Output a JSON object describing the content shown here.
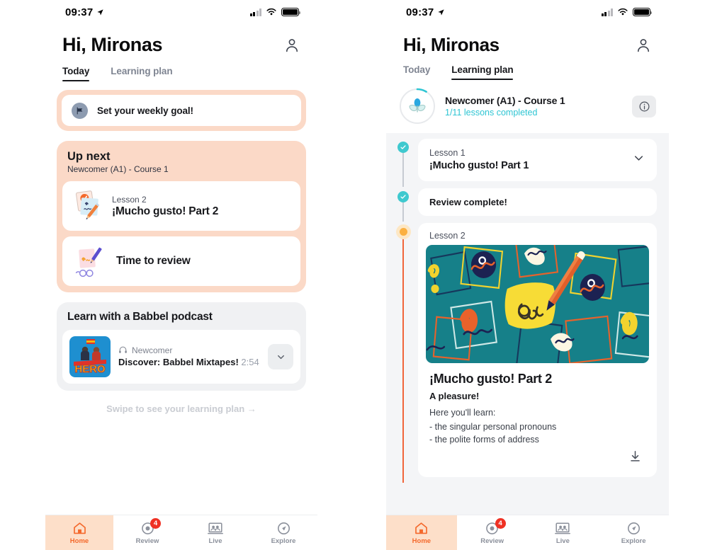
{
  "status_bar": {
    "time": "09:37",
    "location_icon": "location-arrow-icon",
    "signal_icon": "cellular-signal-icon",
    "wifi_icon": "wifi-icon",
    "battery_icon": "battery-icon"
  },
  "left_phone": {
    "header": {
      "greeting": "Hi, Mironas",
      "profile_icon": "person-icon"
    },
    "tabs": [
      {
        "label": "Today",
        "active": true
      },
      {
        "label": "Learning plan",
        "active": false
      }
    ],
    "goal_card": {
      "icon": "flag-icon",
      "label": "Set your weekly goal!"
    },
    "up_next": {
      "title": "Up next",
      "subtitle": "Newcomer (A1) - Course 1",
      "lesson": {
        "icon": "flashcards-pencil-icon",
        "kicker": "Lesson 2",
        "name": "¡Mucho gusto! Part 2"
      },
      "review": {
        "icon": "review-glasses-pencil-icon",
        "name": "Time to review"
      }
    },
    "podcast": {
      "title": "Learn with a Babbel podcast",
      "thumb_icon": "podcast-cover-hero",
      "headphones_icon": "headphones-icon",
      "level": "Newcomer",
      "name": "Discover: Babbel Mixtapes!",
      "duration": "2:54",
      "expand_icon": "chevron-down-icon"
    },
    "swipe_hint": "Swipe to see your learning plan →"
  },
  "right_phone": {
    "header": {
      "greeting": "Hi, Mironas",
      "profile_icon": "person-icon"
    },
    "tabs": [
      {
        "label": "Today",
        "active": false
      },
      {
        "label": "Learning plan",
        "active": true
      }
    ],
    "course": {
      "icon": "sprout-progress-icon",
      "name": "Newcomer (A1) - Course 1",
      "progress": "1/11 lessons completed",
      "info_icon": "info-icon"
    },
    "plan_steps": [
      {
        "state": "done",
        "state_icon": "check-circle-icon",
        "kicker": "Lesson 1",
        "name": "¡Mucho gusto! Part 1",
        "chevron_icon": "chevron-down-icon"
      },
      {
        "state": "done",
        "state_icon": "check-circle-icon",
        "label": "Review complete!"
      },
      {
        "state": "current",
        "state_icon": "current-dot-icon",
        "kicker": "Lesson 2",
        "illustration": "lesson-illustration-notepad-pencil",
        "title": "¡Mucho gusto! Part 2",
        "tagline": "A pleasure!",
        "lead": "Here you'll learn:",
        "bullets": "- the singular personal pronouns\n- the polite forms of address",
        "download_icon": "download-icon"
      }
    ]
  },
  "bottom_nav": [
    {
      "label": "Home",
      "icon": "home-icon",
      "active": true,
      "badge": ""
    },
    {
      "label": "Review",
      "icon": "review-target-icon",
      "active": false,
      "badge": "4"
    },
    {
      "label": "Live",
      "icon": "live-class-icon",
      "active": false,
      "badge": ""
    },
    {
      "label": "Explore",
      "icon": "compass-icon",
      "active": false,
      "badge": ""
    }
  ],
  "colors": {
    "accent_orange": "#f4692c",
    "peach": "#fbd9c7",
    "teal": "#2ec5d3",
    "badge_red": "#ef3124"
  }
}
